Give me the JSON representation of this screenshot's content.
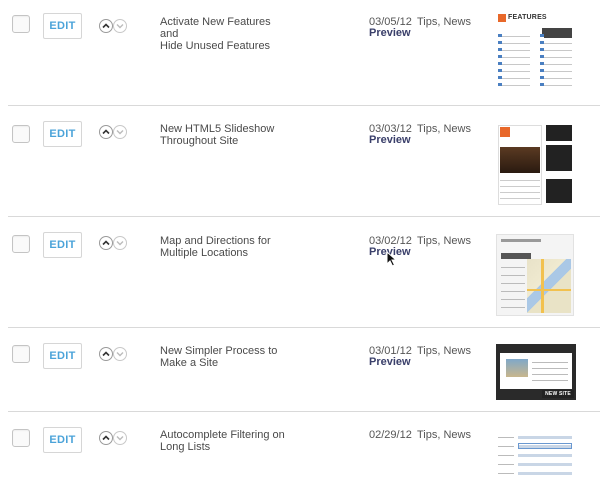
{
  "posts": [
    {
      "edit_label": "EDIT",
      "title_line1": "Activate New Features and",
      "title_line2": "Hide Unused Features",
      "date": "03/05/12",
      "preview_label": "Preview",
      "categories": "Tips, News",
      "thumb_heading": "FEATURES"
    },
    {
      "edit_label": "EDIT",
      "title_line1": "New HTML5 Slideshow",
      "title_line2": "Throughout Site",
      "date": "03/03/12",
      "preview_label": "Preview",
      "categories": "Tips, News"
    },
    {
      "edit_label": "EDIT",
      "title_line1": "Map and Directions for",
      "title_line2": "Multiple Locations",
      "date": "03/02/12",
      "preview_label": "Preview",
      "categories": "Tips, News"
    },
    {
      "edit_label": "EDIT",
      "title_line1": "New Simpler Process to",
      "title_line2": "Make a Site",
      "date": "03/01/12",
      "preview_label": "Preview",
      "categories": "Tips, News",
      "thumb_button": "NEW SITE"
    },
    {
      "edit_label": "EDIT",
      "title_line1": "Autocomplete Filtering on",
      "title_line2": "Long Lists",
      "date": "02/29/12",
      "categories": "Tips, News"
    }
  ],
  "colors": {
    "edit_text": "#4ba3d9",
    "preview_text": "#3a3f6a",
    "divider": "#d9d9d9",
    "accent_orange": "#e8682a"
  }
}
